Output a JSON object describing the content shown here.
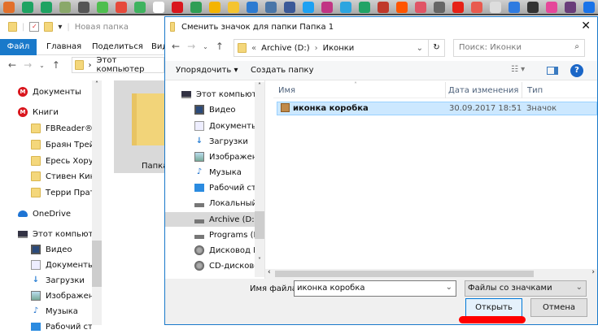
{
  "taskbar_icons": [
    "#e2702b",
    "#1ea362",
    "#1ea362",
    "#8aa86a",
    "#555",
    "#4fbe4f",
    "#e64a3b",
    "#3fb35f",
    "#ffffff",
    "#d9161d",
    "#2f9e55",
    "#f4b400",
    "#f4c430",
    "#2d7bd1",
    "#4a76a8",
    "#3b5998",
    "#1da1f2",
    "#c13584",
    "#2ca5e0",
    "#21a366",
    "#c0392b",
    "#ff5500",
    "#e05566",
    "#666",
    "#e62117",
    "#e85a4f",
    "#ddd",
    "#2f7be0",
    "#333",
    "#e5479a",
    "#6a3d7a",
    "#1a73e8",
    "#f0a020"
  ],
  "explorer": {
    "title": "Новая папка",
    "tabs": [
      "Файл",
      "Главная",
      "Поделиться",
      "Вид"
    ],
    "address": "Этот компьютер",
    "nav": [
      {
        "label": "Документы",
        "icon": "mega-icon"
      },
      {
        "label": "Книги",
        "icon": "mega-icon"
      },
      {
        "label": "FBReader® book",
        "icon": "folder-icon"
      },
      {
        "label": "Браян Трейси -",
        "icon": "folder-icon"
      },
      {
        "label": "Ересь Хоруса",
        "icon": "folder-icon"
      },
      {
        "label": "Стивен Кинг",
        "icon": "folder-icon"
      },
      {
        "label": "Терри Пратчетт",
        "icon": "folder-icon"
      },
      {
        "label": "OneDrive",
        "icon": "onedrive-icon"
      },
      {
        "label": "Этот компьютер",
        "icon": "computer-icon"
      },
      {
        "label": "Видео",
        "icon": "video-icon"
      },
      {
        "label": "Документы",
        "icon": "documents-icon"
      },
      {
        "label": "Загрузки",
        "icon": "downloads-icon"
      },
      {
        "label": "Изображения",
        "icon": "pictures-icon"
      },
      {
        "label": "Музыка",
        "icon": "music-icon"
      },
      {
        "label": "Рабочий стол",
        "icon": "desktop-icon"
      }
    ],
    "folder_label": "Папка"
  },
  "dialog": {
    "title": "Сменить значок для папки Папка 1",
    "breadcrumb": [
      "«",
      "Archive (D:)",
      "›",
      "Иконки"
    ],
    "search_placeholder": "Поиск: Иконки",
    "toolbar": {
      "organize": "Упорядочить ▾",
      "new_folder": "Создать папку"
    },
    "nav": [
      {
        "label": "Этот компьютер",
        "icon": "computer-icon"
      },
      {
        "label": "Видео",
        "icon": "video-icon"
      },
      {
        "label": "Документы",
        "icon": "documents-icon"
      },
      {
        "label": "Загрузки",
        "icon": "downloads-icon"
      },
      {
        "label": "Изображения",
        "icon": "pictures-icon"
      },
      {
        "label": "Музыка",
        "icon": "music-icon"
      },
      {
        "label": "Рабочий стол",
        "icon": "desktop-icon"
      },
      {
        "label": "Локальный дис",
        "icon": "drive-icon"
      },
      {
        "label": "Archive (D:)",
        "icon": "drive-icon",
        "selected": true
      },
      {
        "label": "Programs (E:)",
        "icon": "drive-icon"
      },
      {
        "label": "Дисковод BD-RO",
        "icon": "disc-drive-icon"
      },
      {
        "label": "CD-дисковод (I:",
        "icon": "disc-drive-icon"
      }
    ],
    "columns": [
      "Имя",
      "Дата изменения",
      "Тип"
    ],
    "files": [
      {
        "name": "иконка коробка",
        "date": "30.09.2017 18:51",
        "type": "Значок"
      }
    ],
    "filename_label": "Имя файла:",
    "filename_value": "иконка коробка",
    "filter": "Файлы со значками",
    "open": "Открыть",
    "cancel": "Отмена",
    "highlight_color": "#ff0000"
  }
}
